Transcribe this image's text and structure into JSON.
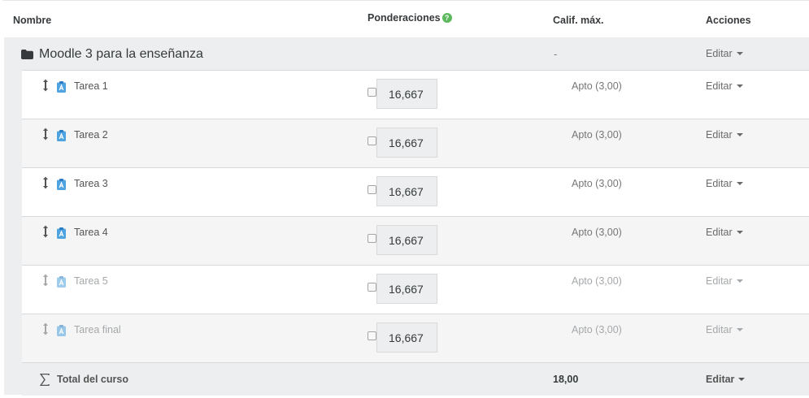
{
  "header": {
    "name_col": "Nombre",
    "weights_col": "Ponderaciones",
    "max_col": "Calif. máx.",
    "actions_col": "Acciones"
  },
  "category": {
    "name": "Moodle 3 para la enseñanza",
    "max": "-",
    "action": "Editar"
  },
  "items": [
    {
      "name": "Tarea 1",
      "weight": "16,667",
      "max": "Apto (3,00)",
      "action": "Editar",
      "hidden": false
    },
    {
      "name": "Tarea 2",
      "weight": "16,667",
      "max": "Apto (3,00)",
      "action": "Editar",
      "hidden": false
    },
    {
      "name": "Tarea 3",
      "weight": "16,667",
      "max": "Apto (3,00)",
      "action": "Editar",
      "hidden": false
    },
    {
      "name": "Tarea 4",
      "weight": "16,667",
      "max": "Apto (3,00)",
      "action": "Editar",
      "hidden": false
    },
    {
      "name": "Tarea 5",
      "weight": "16,667",
      "max": "Apto (3,00)",
      "action": "Editar",
      "hidden": true
    },
    {
      "name": "Tarea final",
      "weight": "16,667",
      "max": "Apto (3,00)",
      "action": "Editar",
      "hidden": true
    }
  ],
  "total": {
    "name": "Total del curso",
    "max": "18,00",
    "action": "Editar"
  },
  "icons": {
    "help": "question-circle-icon",
    "folder": "folder-icon",
    "move": "move-arrows-icon",
    "assignment": "assignment-icon",
    "sum": "sigma-icon"
  },
  "colors": {
    "help_icon": "#5cb85c",
    "assignment_icon": "#4fa3e0",
    "category_background": "#eceeef"
  }
}
